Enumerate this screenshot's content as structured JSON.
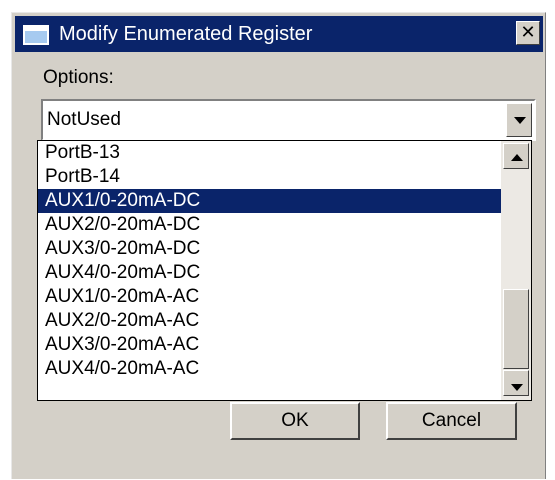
{
  "window": {
    "title": "Modify Enumerated Register",
    "close_glyph": "✕"
  },
  "options": {
    "label": "Options:",
    "selected_value": "NotUsed",
    "items": [
      "PortB-13",
      "PortB-14",
      "AUX1/0-20mA-DC",
      "AUX2/0-20mA-DC",
      "AUX3/0-20mA-DC",
      "AUX4/0-20mA-DC",
      "AUX1/0-20mA-AC",
      "AUX2/0-20mA-AC",
      "AUX3/0-20mA-AC",
      "AUX4/0-20mA-AC"
    ],
    "highlighted_item": "AUX1/0-20mA-DC"
  },
  "buttons": {
    "ok": "OK",
    "cancel": "Cancel"
  },
  "colors": {
    "titlebar": "#0a246a",
    "dialog_face": "#d4d0c8",
    "highlight": "#0a246a",
    "highlight_text": "#ffffff"
  }
}
